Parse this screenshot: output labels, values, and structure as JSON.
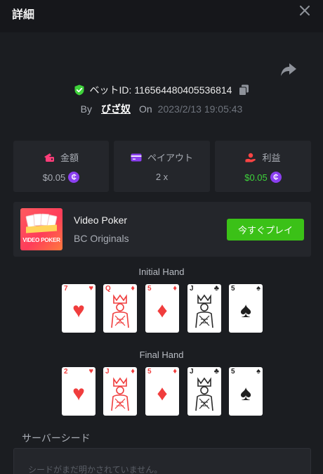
{
  "header": {
    "title": "詳細",
    "close_icon": "close-icon"
  },
  "bet": {
    "id_label": "ベットID: 116564480405536814",
    "by_label": "By",
    "user": "びざ奴",
    "on_label": "On",
    "date": "2023/2/13 19:05:43"
  },
  "stats": [
    {
      "label": "金額",
      "value": "$0.05",
      "icon": "wallet-icon",
      "icon_color": "#ff3d79"
    },
    {
      "label": "ペイアウト",
      "value": "2 x",
      "icon": "card-icon",
      "icon_color": "#8b3ff0"
    },
    {
      "label": "利益",
      "value": "$0.05",
      "icon": "profit-icon",
      "icon_color": "#ff4444",
      "value_color": "#3ed23a"
    }
  ],
  "coin_symbol": "₵",
  "game": {
    "thumb_text": "VIDEO POKER",
    "name": "Video Poker",
    "provider": "BC Originals",
    "play_label": "今すぐプレイ"
  },
  "initial_hand": {
    "title": "Initial Hand",
    "cards": [
      {
        "rank": "7",
        "suit": "♥",
        "color": "red",
        "face": false
      },
      {
        "rank": "Q",
        "suit": "♦",
        "color": "red",
        "face": true
      },
      {
        "rank": "5",
        "suit": "♦",
        "color": "red",
        "face": false
      },
      {
        "rank": "J",
        "suit": "♣",
        "color": "black",
        "face": true
      },
      {
        "rank": "5",
        "suit": "♠",
        "color": "black",
        "face": false
      }
    ]
  },
  "final_hand": {
    "title": "Final Hand",
    "cards": [
      {
        "rank": "2",
        "suit": "♥",
        "color": "red",
        "face": false
      },
      {
        "rank": "J",
        "suit": "♦",
        "color": "red",
        "face": true
      },
      {
        "rank": "5",
        "suit": "♦",
        "color": "red",
        "face": false
      },
      {
        "rank": "J",
        "suit": "♣",
        "color": "black",
        "face": true
      },
      {
        "rank": "5",
        "suit": "♠",
        "color": "black",
        "face": false
      }
    ]
  },
  "seed": {
    "title": "サーバーシード",
    "placeholder": "シードがまだ明かされていません。"
  },
  "colors": {
    "accent_green": "#3bc117",
    "background": "#1b1d21",
    "panel": "#24262b"
  }
}
